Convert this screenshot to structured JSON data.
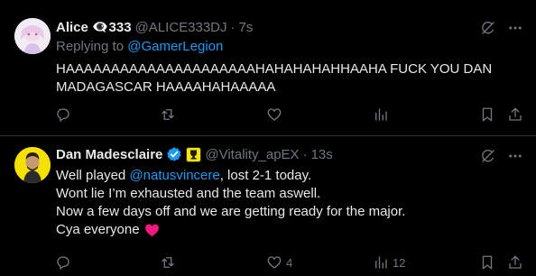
{
  "tweets": [
    {
      "name": "Alice",
      "name_suffix": "👁‍🗨333",
      "handle": "@ALICE333DJ",
      "time": "7s",
      "replying_prefix": "Replying to",
      "replying_to": "@GamerLegion",
      "lines": [
        "HAAAAAAAAAAAAAAAAAAAAAHAHAHAHAHHAAHA FUCK YOU DAN",
        "MADAGASCAR HAAAAHAHAAAAA"
      ],
      "actions": {
        "replies": "",
        "reposts": "",
        "likes": "",
        "views": ""
      }
    },
    {
      "name": "Dan Madesclaire",
      "handle": "@Vitality_apEX",
      "time": "13s",
      "line1_prefix": "Well played ",
      "line1_mention": "@natusvincere",
      "line1_suffix": ", lost 2-1 today.",
      "line2": "Wont lie I’m exhausted and the team aswell.",
      "line3": "Now a few days off and we are getting ready for the major.",
      "line4": "Cya everyone",
      "actions": {
        "replies": "",
        "reposts": "",
        "likes": "4",
        "views": "12"
      }
    }
  ],
  "colors": {
    "background": "#000000",
    "text": "#e7e9ea",
    "muted": "#71767b",
    "link": "#1d9bf0",
    "divider": "#2f3336",
    "verified": "#1d9bf0",
    "heart": "#f91880",
    "affiliate_badge": "#f6e600"
  },
  "icons": [
    "reply-icon",
    "repost-icon",
    "like-icon",
    "views-icon",
    "bookmark-icon",
    "share-icon",
    "grok-icon",
    "more-icon",
    "verified-icon",
    "heart-emoji-icon"
  ]
}
